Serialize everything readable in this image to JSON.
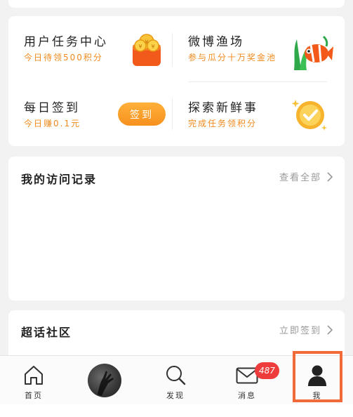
{
  "tasks": {
    "user_task_center": {
      "title": "用户任务中心",
      "subtitle": "今日待领500积分",
      "icon": "coin-wallet-icon"
    },
    "weibo_fishery": {
      "title": "微博渔场",
      "subtitle": "参与瓜分十万奖金池",
      "icon": "fish-icon"
    },
    "daily_checkin": {
      "title": "每日签到",
      "subtitle": "今日赚0.1元",
      "button_label": "签到"
    },
    "explore_news": {
      "title": "探索新鲜事",
      "subtitle": "完成任务领积分",
      "icon": "medal-icon"
    }
  },
  "visits": {
    "title": "我的访问记录",
    "link_label": "查看全部"
  },
  "super_topic": {
    "title": "超话社区",
    "link_label": "立即签到"
  },
  "tabbar": {
    "home_label": "首页",
    "discover_label": "发现",
    "messages_label": "消息",
    "messages_badge": "487",
    "me_label": "我"
  },
  "colors": {
    "accent_orange": "#f08a1d",
    "badge_red": "#ee3b3b",
    "highlight": "#f06a3a"
  }
}
